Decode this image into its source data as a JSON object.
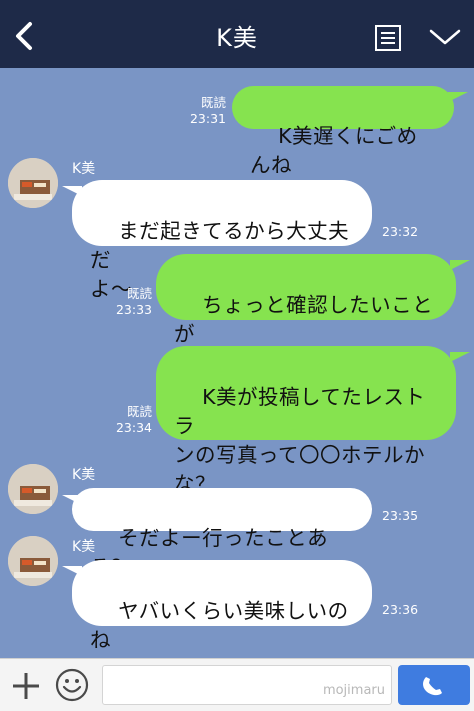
{
  "header": {
    "title": "K美"
  },
  "messages": [
    {
      "direction": "out",
      "text": "K美遅くにごめんね",
      "read_label": "既読",
      "time": "23:31"
    },
    {
      "direction": "in",
      "sender": "K美",
      "text": "まだ起きてるから大丈夫だ\nよ〜",
      "time": "23:32"
    },
    {
      "direction": "out",
      "text": "ちょっと確認したいことが\nあってね",
      "read_label": "既読",
      "time": "23:33"
    },
    {
      "direction": "out",
      "text": "K美が投稿してたレストラ\nンの写真って〇〇ホテルか\nな？",
      "read_label": "既読",
      "time": "23:34"
    },
    {
      "direction": "in",
      "sender": "K美",
      "text": "そだよー行ったことある？",
      "time": "23:35"
    },
    {
      "direction": "in",
      "sender": "K美",
      "text": "ヤバいくらい美味しいのね\n！",
      "time": "23:36"
    }
  ],
  "input": {
    "watermark": "mojimaru"
  },
  "icons": {
    "back": "chevron-left-icon",
    "menu": "list-icon",
    "dropdown": "chevron-down-icon",
    "add": "plus-icon",
    "emoji": "smiley-icon",
    "call": "phone-icon"
  },
  "colors": {
    "header": "#1e2a48",
    "chat_background": "#7a95c5",
    "outgoing_bubble": "#86e34f",
    "incoming_bubble": "#ffffff",
    "call_button": "#3f7ce0"
  }
}
